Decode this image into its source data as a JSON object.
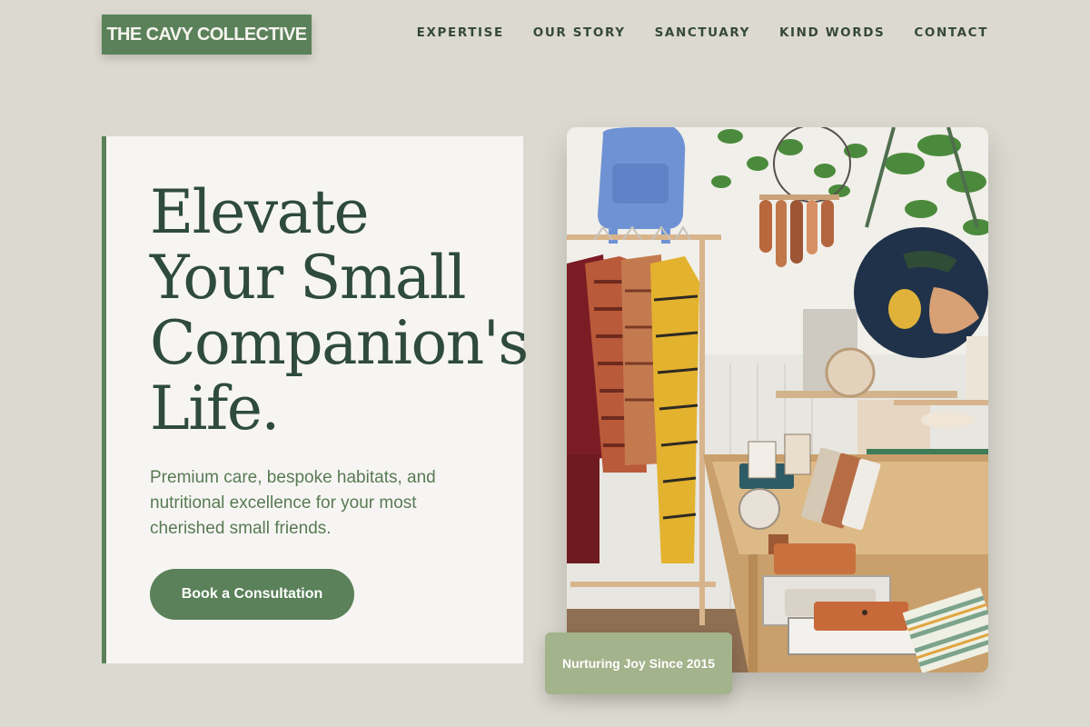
{
  "header": {
    "logo": "THE CAVY COLLECTIVE",
    "nav": [
      "EXPERTISE",
      "OUR STORY",
      "SANCTUARY",
      "KIND WORDS",
      "CONTACT"
    ]
  },
  "hero": {
    "title_lines": [
      "Elevate",
      "Your Small",
      "Companion's",
      "Life."
    ],
    "subtitle": "Premium care, bespoke habitats, and nutritional excellence for your most cherished small friends.",
    "cta_label": "Book a Consultation"
  },
  "image": {
    "badge": "Nurturing Joy Since 2015"
  },
  "colors": {
    "background": "#dcdad0",
    "brand_green": "#5a8159",
    "title_green": "#2e4b3d",
    "badge_sage": "#a3b38b",
    "card": "#f7f5f3"
  }
}
